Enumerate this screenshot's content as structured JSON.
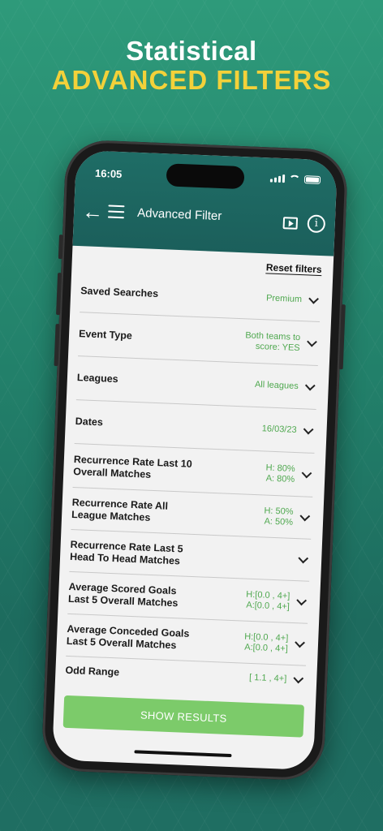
{
  "headline": {
    "line1": "Statistical",
    "line2": "ADVANCED FILTERS"
  },
  "status_bar": {
    "time": "16:05"
  },
  "nav": {
    "title": "Advanced Filter",
    "back_icon": "back-arrow-icon",
    "menu_icon": "hamburger-menu-icon",
    "video_icon": "video-play-icon",
    "info_icon": "info-icon"
  },
  "reset_label": "Reset filters",
  "filters": [
    {
      "label": "Saved Searches",
      "value": "Premium"
    },
    {
      "label": "Event Type",
      "value": "Both teams to\nscore: YES"
    },
    {
      "label": "Leagues",
      "value": "All leagues"
    },
    {
      "label": "Dates",
      "value": "16/03/23"
    },
    {
      "label": "Recurrence Rate Last 10 Overall Matches",
      "value": "H: 80%\nA: 80%"
    },
    {
      "label": "Recurrence Rate All League Matches",
      "value": "H: 50%\nA: 50%"
    },
    {
      "label": "Recurrence Rate Last 5 Head To Head Matches",
      "value": ""
    },
    {
      "label": "Average Scored Goals Last 5 Overall Matches",
      "value": "H:[0.0 , 4+]\nA:[0.0 , 4+]"
    },
    {
      "label": "Average Conceded Goals Last 5 Overall Matches",
      "value": "H:[0.0 , 4+]\nA:[0.0 , 4+]"
    },
    {
      "label": "Odd Range",
      "value": "[ 1.1 , 4+]"
    }
  ],
  "show_results_label": "SHOW RESULTS",
  "colors": {
    "background": "#2e9a7a",
    "accent_yellow": "#f3d13a",
    "header_teal": "#1f6d66",
    "value_green": "#4fa84f",
    "button_green": "#7ccb6a"
  }
}
